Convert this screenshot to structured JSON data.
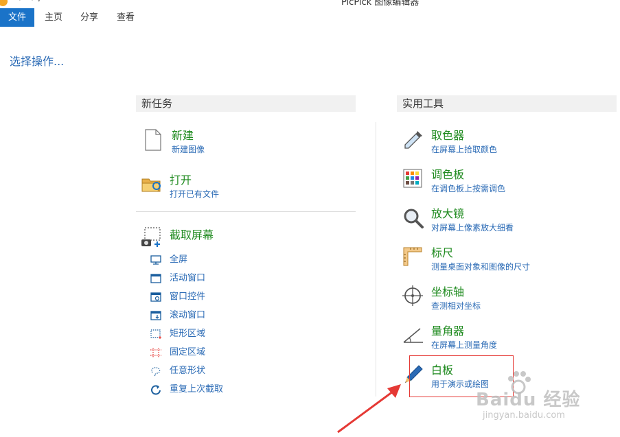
{
  "window": {
    "title": "PicPick 图像编辑器"
  },
  "menu": {
    "file": "文件",
    "home": "主页",
    "share": "分享",
    "view": "查看"
  },
  "prompt": "选择操作...",
  "sections": {
    "new_tasks": "新任务",
    "utilities": "实用工具"
  },
  "new_tasks": {
    "new": {
      "title": "新建",
      "subtitle": "新建图像",
      "icon": "blank-document-icon"
    },
    "open": {
      "title": "打开",
      "subtitle": "打开已有文件",
      "icon": "open-folder-icon"
    },
    "capture": {
      "title": "截取屏幕",
      "icon": "screen-capture-icon"
    }
  },
  "capture_items": [
    {
      "label": "全屏",
      "icon": "monitor-icon"
    },
    {
      "label": "活动窗口",
      "icon": "window-icon"
    },
    {
      "label": "窗口控件",
      "icon": "window-control-icon"
    },
    {
      "label": "滚动窗口",
      "icon": "scroll-window-icon"
    },
    {
      "label": "矩形区域",
      "icon": "rectangle-region-icon"
    },
    {
      "label": "固定区域",
      "icon": "fixed-region-icon"
    },
    {
      "label": "任意形状",
      "icon": "freehand-shape-icon"
    },
    {
      "label": "重复上次截取",
      "icon": "repeat-capture-icon"
    }
  ],
  "utilities": [
    {
      "title": "取色器",
      "subtitle": "在屏幕上拾取颜色",
      "icon": "eyedropper-icon"
    },
    {
      "title": "调色板",
      "subtitle": "在调色板上按需调色",
      "icon": "color-palette-icon"
    },
    {
      "title": "放大镜",
      "subtitle": "对屏幕上像素放大细看",
      "icon": "magnifier-icon"
    },
    {
      "title": "标尺",
      "subtitle": "测量桌面对象和图像的尺寸",
      "icon": "ruler-icon"
    },
    {
      "title": "坐标轴",
      "subtitle": "查测相对坐标",
      "icon": "crosshair-icon"
    },
    {
      "title": "量角器",
      "subtitle": "在屏幕上测量角度",
      "icon": "protractor-icon"
    },
    {
      "title": "白板",
      "subtitle": "用于演示或绘图",
      "icon": "pen-icon"
    }
  ],
  "watermark": {
    "brand": "Baidu 经验",
    "url": "jingyan.baidu.com"
  },
  "colors": {
    "accent": "#1a73c8",
    "title_green": "#1e8a1e",
    "link_blue": "#2a6ab5",
    "highlight_red": "#e53935"
  }
}
